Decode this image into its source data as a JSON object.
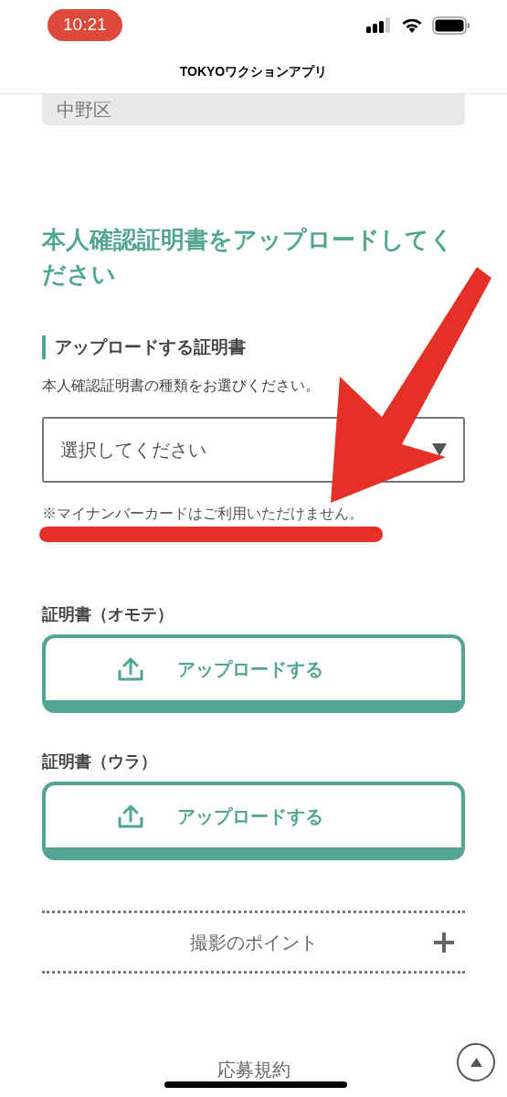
{
  "status_bar": {
    "time": "10:21"
  },
  "header": {
    "title": "TOKYOワクションアプリ"
  },
  "previous_field": {
    "value": "中野区"
  },
  "section": {
    "heading": "本人確認証明書をアップロードしてください",
    "subheading": "アップロードする証明書",
    "description": "本人確認証明書の種類をお選びください。",
    "select": {
      "placeholder": "選択してください"
    },
    "note": "※マイナンバーカードはご利用いただけません。"
  },
  "uploads": [
    {
      "label": "証明書（オモテ）",
      "button": "アップロードする"
    },
    {
      "label": "証明書（ウラ）",
      "button": "アップロードする"
    }
  ],
  "accordion": {
    "label": "撮影のポイント",
    "expanded": false
  },
  "footer_link": "応募規約",
  "annotations": {
    "arrow": true,
    "underline": true
  }
}
